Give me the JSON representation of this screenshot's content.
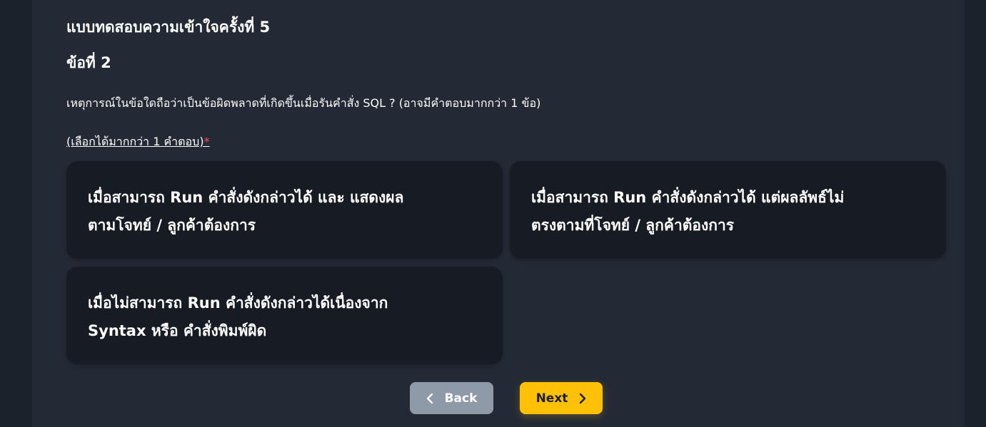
{
  "quiz": {
    "title": "แบบทดสอบความเข้าใจครั้งที่ 5",
    "question_number": "ข้อที่ 2",
    "question_text": "เหตุการณ์ในข้อใดถือว่าเป็นข้อผิดพลาดที่เกิดขึ้นเมื่อรันคำสั่ง SQL ? (อาจมีคำตอบมากกว่า 1 ข้อ)",
    "multi_select_hint": "(เลือกได้มากกว่า 1 คำตอบ)",
    "required_marker": "*"
  },
  "options": [
    {
      "line1": "เมื่อสามารถ Run คำสั่งดังกล่าวได้ และ แสดงผล",
      "line2": "ตามโจทย์ / ลูกค้าต้องการ"
    },
    {
      "line1": "เมื่อสามารถ Run คำสั่งดังกล่าวได้ แต่ผลลัพธ์ไม่",
      "line2": "ตรงตามที่โจทย์ / ลูกค้าต้องการ"
    },
    {
      "line1": "เมื่อไม่สามารถ Run คำสั่งดังกล่าวได้เนื่องจาก",
      "line2": "Syntax หรือ คำสั่งพิมพ์ผิด"
    }
  ],
  "nav": {
    "back_label": "Back",
    "next_label": "Next",
    "back_icon": "chevron-left-icon",
    "next_icon": "chevron-right-icon"
  },
  "colors": {
    "page_bg": "#232a35",
    "card_bg": "#171c24",
    "back_button": "#8f9aa8",
    "next_button": "#ffc107",
    "required": "#ff4d5e"
  }
}
